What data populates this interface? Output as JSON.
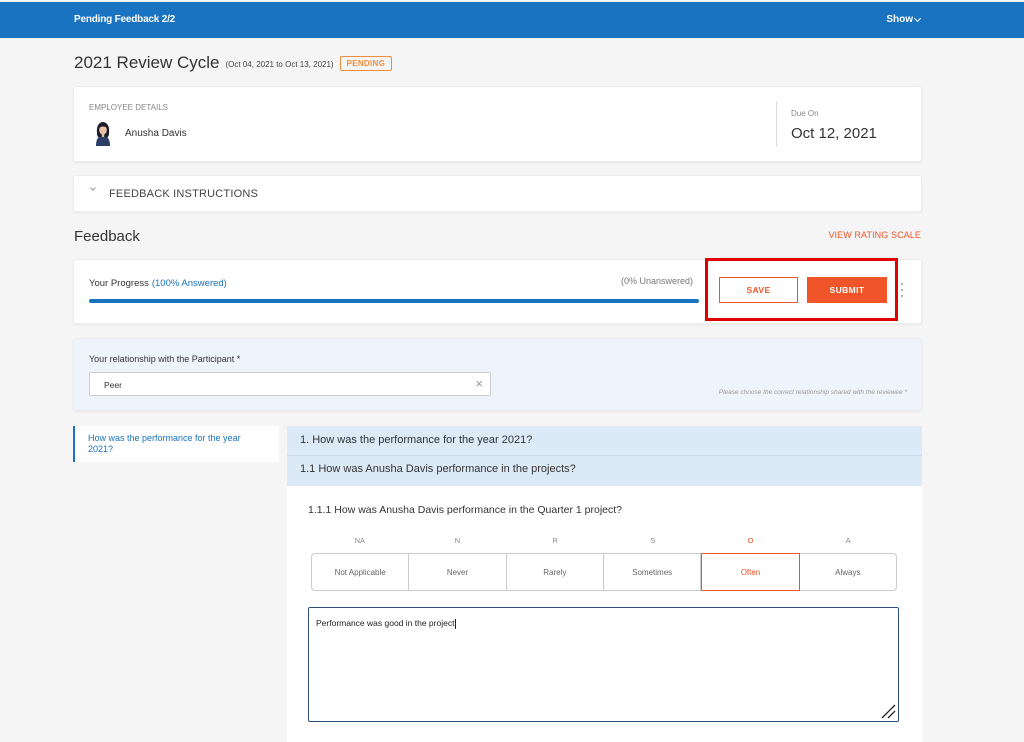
{
  "topbar": {
    "title": "Pending Feedback 2/2",
    "show_label": "Show"
  },
  "cycle": {
    "name": "2021 Review Cycle",
    "range": "(Oct 04, 2021 to Oct 13, 2021)",
    "status": "PENDING"
  },
  "employee": {
    "section_label": "EMPLOYEE DETAILS",
    "name": "Anusha Davis",
    "due_label": "Due On",
    "due_date": "Oct 12, 2021"
  },
  "instructions": {
    "label": "FEEDBACK INSTRUCTIONS"
  },
  "feedback": {
    "title": "Feedback",
    "rating_scale_link": "VIEW RATING SCALE"
  },
  "progress": {
    "label": "Your Progress",
    "answered": "(100% Answered)",
    "unanswered": "(0% Unanswered)",
    "fraction": 1.0,
    "save_label": "SAVE",
    "submit_label": "SUBMIT"
  },
  "relationship": {
    "label": "Your relationship with the Participant *",
    "value": "Peer",
    "hint": "Please choose the correct relationship shared with the reviewee *"
  },
  "sidebar": {
    "items": [
      {
        "label": "How was the performance for the year 2021?"
      }
    ]
  },
  "questions": {
    "q1": "1. How was the performance for the year 2021?",
    "q1_1": "1.1 How was Anusha Davis performance in the projects?",
    "q1_1_1": "1.1.1 How was Anusha Davis performance in the Quarter 1 project?",
    "scale": [
      {
        "letter": "NA",
        "label": "Not Applicable"
      },
      {
        "letter": "N",
        "label": "Never"
      },
      {
        "letter": "R",
        "label": "Rarely"
      },
      {
        "letter": "S",
        "label": "Sometimes"
      },
      {
        "letter": "O",
        "label": "Often"
      },
      {
        "letter": "A",
        "label": "Always"
      }
    ],
    "selected": "Often",
    "comment": "Performance was good in the project"
  },
  "colors": {
    "primary": "#1a73c0",
    "accent": "#f0552a",
    "highlight": "#e10000"
  }
}
